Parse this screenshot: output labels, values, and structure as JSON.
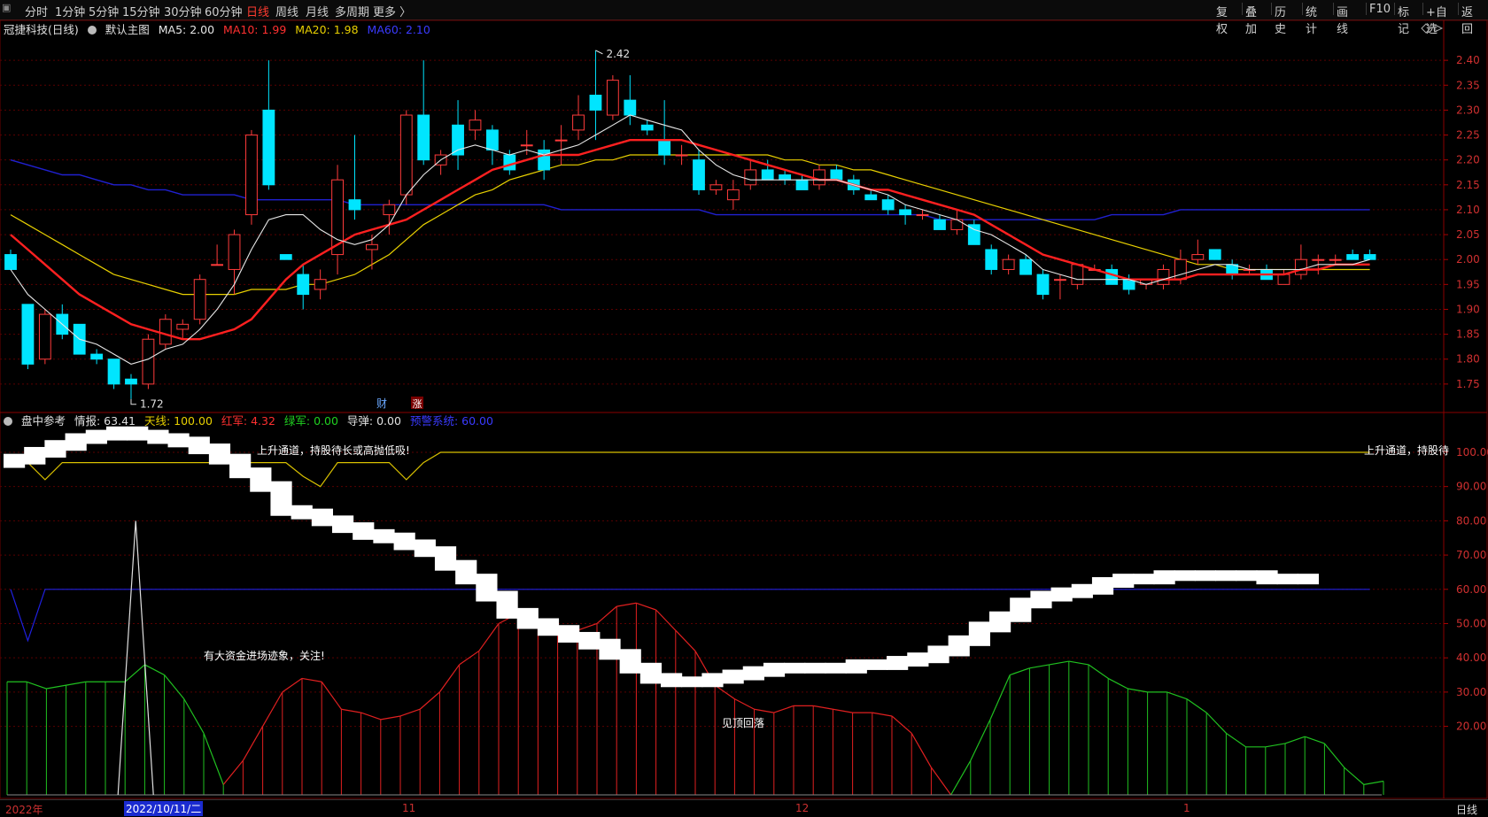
{
  "toolbar": {
    "left_items": [
      "分时",
      "1分钟",
      "5分钟",
      "15分钟",
      "30分钟",
      "60分钟",
      "日线",
      "周线",
      "月线",
      "多周期",
      "更多 〉"
    ],
    "active": "日线",
    "right_items": [
      "复权",
      "叠加",
      "历史",
      "统计",
      "画线",
      "F10",
      "标记",
      "+自选",
      "返回"
    ]
  },
  "main_legend": {
    "stock": "冠捷科技(日线)",
    "template": "默认主图",
    "ma5": "MA5: 2.00",
    "ma10": "MA10: 1.99",
    "ma20": "MA20: 1.98",
    "ma60": "MA60: 2.10"
  },
  "sub_legend": {
    "name": "盘中参考",
    "qingbao": "情报: 63.41",
    "tianxian": "天线: 100.00",
    "hongjun": "红军: 4.32",
    "lvjun": "绿军: 0.00",
    "daodan": "导弹: 0.00",
    "yujing": "预警系统: 60.00"
  },
  "colors": {
    "up": "#ff3b3b",
    "down": "#00e5ff",
    "ma5": "#e6e6e6",
    "ma10": "#ff2020",
    "ma20": "#e8d000",
    "ma60": "#2020d0",
    "grid": "#5a0000"
  },
  "price_axis": [
    "2.40",
    "2.35",
    "2.30",
    "2.25",
    "2.20",
    "2.15",
    "2.10",
    "2.05",
    "2.00",
    "1.95",
    "1.90",
    "1.85",
    "1.80",
    "1.75"
  ],
  "sub_axis": [
    "100.00",
    "90.00",
    "80.00",
    "70.00",
    "60.00",
    "50.00",
    "40.00",
    "30.00",
    "20.00"
  ],
  "annotations": {
    "high": "2.42",
    "low": "1.72",
    "cai": "财",
    "zhang": "涨",
    "up_channel": "上升通道，持股待长或高抛低吸!",
    "up_channel_right": "上升通道，持股待",
    "big_money": "有大资金进场迹象，关注!",
    "top_fall": "见顶回落"
  },
  "time_axis": {
    "year": "2022年",
    "cursor_date": "2022/10/11/二",
    "m11": "11",
    "m12": "12",
    "m1": "1",
    "period": "日线"
  },
  "chart_data": {
    "type": "candlestick",
    "ohlc": [
      [
        2.01,
        2.02,
        1.98,
        1.98
      ],
      [
        1.91,
        1.91,
        1.78,
        1.79
      ],
      [
        1.8,
        1.9,
        1.79,
        1.89
      ],
      [
        1.89,
        1.91,
        1.84,
        1.85
      ],
      [
        1.87,
        1.87,
        1.81,
        1.81
      ],
      [
        1.81,
        1.82,
        1.79,
        1.8
      ],
      [
        1.8,
        1.8,
        1.74,
        1.75
      ],
      [
        1.76,
        1.77,
        1.72,
        1.75
      ],
      [
        1.75,
        1.85,
        1.74,
        1.84
      ],
      [
        1.83,
        1.89,
        1.82,
        1.88
      ],
      [
        1.86,
        1.88,
        1.84,
        1.87
      ],
      [
        1.88,
        1.97,
        1.87,
        1.96
      ],
      [
        1.99,
        2.03,
        1.99,
        1.99
      ],
      [
        1.98,
        2.06,
        1.93,
        2.05
      ],
      [
        2.09,
        2.26,
        2.07,
        2.25
      ],
      [
        2.3,
        2.4,
        2.14,
        2.15
      ],
      [
        2.01,
        2.01,
        2.0,
        2.0
      ],
      [
        1.97,
        1.99,
        1.9,
        1.93
      ],
      [
        1.94,
        1.98,
        1.92,
        1.96
      ],
      [
        2.01,
        2.19,
        1.97,
        2.16
      ],
      [
        2.12,
        2.25,
        2.08,
        2.1
      ],
      [
        2.02,
        2.05,
        1.98,
        2.03
      ],
      [
        2.09,
        2.12,
        2.05,
        2.11
      ],
      [
        2.13,
        2.3,
        2.11,
        2.29
      ],
      [
        2.29,
        2.4,
        2.19,
        2.2
      ],
      [
        2.19,
        2.22,
        2.17,
        2.21
      ],
      [
        2.27,
        2.32,
        2.18,
        2.21
      ],
      [
        2.26,
        2.3,
        2.24,
        2.28
      ],
      [
        2.26,
        2.27,
        2.19,
        2.22
      ],
      [
        2.21,
        2.22,
        2.17,
        2.18
      ],
      [
        2.23,
        2.26,
        2.21,
        2.23
      ],
      [
        2.22,
        2.24,
        2.16,
        2.18
      ],
      [
        2.24,
        2.27,
        2.19,
        2.24
      ],
      [
        2.26,
        2.33,
        2.24,
        2.29
      ],
      [
        2.33,
        2.42,
        2.24,
        2.3
      ],
      [
        2.29,
        2.37,
        2.28,
        2.36
      ],
      [
        2.32,
        2.37,
        2.27,
        2.29
      ],
      [
        2.27,
        2.28,
        2.25,
        2.26
      ],
      [
        2.24,
        2.32,
        2.19,
        2.21
      ],
      [
        2.21,
        2.23,
        2.19,
        2.21
      ],
      [
        2.2,
        2.22,
        2.13,
        2.14
      ],
      [
        2.14,
        2.16,
        2.13,
        2.15
      ],
      [
        2.12,
        2.16,
        2.1,
        2.14
      ],
      [
        2.15,
        2.2,
        2.14,
        2.18
      ],
      [
        2.18,
        2.2,
        2.16,
        2.16
      ],
      [
        2.17,
        2.18,
        2.15,
        2.16
      ],
      [
        2.16,
        2.17,
        2.14,
        2.14
      ],
      [
        2.15,
        2.19,
        2.14,
        2.18
      ],
      [
        2.18,
        2.19,
        2.16,
        2.16
      ],
      [
        2.16,
        2.17,
        2.13,
        2.14
      ],
      [
        2.13,
        2.14,
        2.12,
        2.12
      ],
      [
        2.12,
        2.13,
        2.09,
        2.1
      ],
      [
        2.1,
        2.11,
        2.07,
        2.09
      ],
      [
        2.09,
        2.1,
        2.08,
        2.09
      ],
      [
        2.08,
        2.09,
        2.06,
        2.06
      ],
      [
        2.06,
        2.1,
        2.05,
        2.08
      ],
      [
        2.07,
        2.08,
        2.03,
        2.03
      ],
      [
        2.02,
        2.03,
        1.97,
        1.98
      ],
      [
        1.98,
        2.01,
        1.97,
        2.0
      ],
      [
        2.0,
        2.01,
        1.97,
        1.97
      ],
      [
        1.97,
        1.98,
        1.92,
        1.93
      ],
      [
        1.96,
        1.97,
        1.92,
        1.96
      ],
      [
        1.95,
        1.99,
        1.94,
        1.99
      ],
      [
        1.98,
        1.99,
        1.98,
        1.98
      ],
      [
        1.98,
        1.99,
        1.95,
        1.95
      ],
      [
        1.96,
        1.97,
        1.93,
        1.94
      ],
      [
        1.95,
        1.96,
        1.94,
        1.96
      ],
      [
        1.95,
        1.99,
        1.94,
        1.98
      ],
      [
        1.96,
        2.02,
        1.95,
        2.0
      ],
      [
        2.0,
        2.04,
        1.99,
        2.01
      ],
      [
        2.02,
        2.02,
        2.0,
        2.0
      ],
      [
        1.99,
        2.0,
        1.96,
        1.97
      ],
      [
        1.98,
        1.99,
        1.97,
        1.98
      ],
      [
        1.98,
        1.99,
        1.96,
        1.96
      ],
      [
        1.95,
        1.98,
        1.95,
        1.97
      ],
      [
        1.97,
        2.03,
        1.96,
        2.0
      ],
      [
        2.0,
        2.01,
        1.97,
        2.0
      ],
      [
        2.0,
        2.01,
        1.99,
        2.0
      ],
      [
        2.01,
        2.02,
        2.0,
        2.0
      ],
      [
        2.01,
        2.02,
        2.0,
        2.0
      ]
    ],
    "ma5": [
      1.98,
      1.93,
      1.9,
      1.87,
      1.84,
      1.83,
      1.81,
      1.79,
      1.8,
      1.82,
      1.83,
      1.86,
      1.9,
      1.95,
      2.02,
      2.08,
      2.09,
      2.09,
      2.06,
      2.04,
      2.03,
      2.04,
      2.07,
      2.13,
      2.17,
      2.2,
      2.22,
      2.23,
      2.22,
      2.21,
      2.22,
      2.21,
      2.22,
      2.23,
      2.25,
      2.27,
      2.29,
      2.28,
      2.27,
      2.26,
      2.22,
      2.19,
      2.17,
      2.16,
      2.16,
      2.16,
      2.16,
      2.16,
      2.16,
      2.15,
      2.14,
      2.13,
      2.11,
      2.1,
      2.09,
      2.08,
      2.06,
      2.05,
      2.03,
      2.01,
      1.98,
      1.97,
      1.96,
      1.96,
      1.96,
      1.96,
      1.95,
      1.96,
      1.97,
      1.98,
      1.99,
      1.99,
      1.98,
      1.98,
      1.98,
      1.98,
      1.99,
      1.99,
      1.99,
      2.0
    ],
    "ma10": [
      2.05,
      2.02,
      1.99,
      1.96,
      1.93,
      1.91,
      1.89,
      1.87,
      1.86,
      1.85,
      1.84,
      1.84,
      1.85,
      1.86,
      1.88,
      1.92,
      1.96,
      1.99,
      2.01,
      2.03,
      2.05,
      2.06,
      2.07,
      2.08,
      2.1,
      2.12,
      2.14,
      2.16,
      2.18,
      2.19,
      2.2,
      2.21,
      2.21,
      2.21,
      2.22,
      2.23,
      2.24,
      2.24,
      2.24,
      2.24,
      2.23,
      2.22,
      2.21,
      2.2,
      2.19,
      2.18,
      2.17,
      2.16,
      2.16,
      2.15,
      2.14,
      2.14,
      2.13,
      2.12,
      2.11,
      2.1,
      2.09,
      2.07,
      2.05,
      2.03,
      2.01,
      2.0,
      1.99,
      1.98,
      1.97,
      1.96,
      1.96,
      1.96,
      1.96,
      1.97,
      1.97,
      1.97,
      1.97,
      1.97,
      1.97,
      1.98,
      1.98,
      1.99,
      1.99,
      1.99
    ],
    "ma20": [
      2.09,
      2.07,
      2.05,
      2.03,
      2.01,
      1.99,
      1.97,
      1.96,
      1.95,
      1.94,
      1.93,
      1.93,
      1.93,
      1.93,
      1.94,
      1.94,
      1.94,
      1.95,
      1.95,
      1.96,
      1.97,
      1.99,
      2.01,
      2.04,
      2.07,
      2.09,
      2.11,
      2.13,
      2.14,
      2.16,
      2.17,
      2.18,
      2.19,
      2.19,
      2.2,
      2.2,
      2.21,
      2.21,
      2.21,
      2.21,
      2.21,
      2.21,
      2.21,
      2.21,
      2.21,
      2.2,
      2.2,
      2.19,
      2.19,
      2.18,
      2.18,
      2.17,
      2.16,
      2.15,
      2.14,
      2.13,
      2.12,
      2.11,
      2.1,
      2.09,
      2.08,
      2.07,
      2.06,
      2.05,
      2.04,
      2.03,
      2.02,
      2.01,
      2.0,
      1.99,
      1.99,
      1.98,
      1.98,
      1.98,
      1.98,
      1.98,
      1.98,
      1.98,
      1.98,
      1.98
    ],
    "ma60": [
      2.2,
      2.19,
      2.18,
      2.17,
      2.17,
      2.16,
      2.15,
      2.15,
      2.14,
      2.14,
      2.13,
      2.13,
      2.13,
      2.13,
      2.12,
      2.12,
      2.12,
      2.12,
      2.12,
      2.12,
      2.11,
      2.11,
      2.11,
      2.11,
      2.11,
      2.11,
      2.11,
      2.11,
      2.11,
      2.11,
      2.11,
      2.11,
      2.1,
      2.1,
      2.1,
      2.1,
      2.1,
      2.1,
      2.1,
      2.1,
      2.1,
      2.09,
      2.09,
      2.09,
      2.09,
      2.09,
      2.09,
      2.09,
      2.09,
      2.09,
      2.09,
      2.09,
      2.09,
      2.09,
      2.08,
      2.08,
      2.08,
      2.08,
      2.08,
      2.08,
      2.08,
      2.08,
      2.08,
      2.08,
      2.09,
      2.09,
      2.09,
      2.09,
      2.1,
      2.1,
      2.1,
      2.1,
      2.1,
      2.1,
      2.1,
      2.1,
      2.1,
      2.1,
      2.1,
      2.1
    ],
    "ylim": [
      1.7,
      2.45
    ],
    "sub_ylim": [
      0,
      108
    ],
    "sub_tianxian": [
      97,
      97,
      92,
      97,
      97,
      97,
      97,
      97,
      97,
      97,
      97,
      97,
      97,
      97,
      97,
      97,
      97,
      93,
      90,
      97,
      97,
      97,
      97,
      92,
      97,
      100,
      100,
      100,
      100,
      100,
      100,
      100,
      100,
      100,
      100,
      100,
      100,
      100,
      100,
      100,
      100,
      100,
      100,
      100,
      100,
      100,
      100,
      100,
      100,
      100,
      100,
      100,
      100,
      100,
      100,
      100,
      100,
      100,
      100,
      100,
      100,
      100,
      100,
      100,
      100,
      100,
      100,
      100,
      100,
      100,
      100,
      100,
      100,
      100,
      100,
      100,
      100,
      100,
      100,
      100
    ],
    "sub_yujing": [
      60,
      45,
      60,
      60,
      60,
      60,
      60,
      60,
      60,
      60,
      60,
      60,
      60,
      60,
      60,
      60,
      60,
      60,
      60,
      60,
      60,
      60,
      60,
      60,
      60,
      60,
      60,
      60,
      60,
      60,
      60,
      60,
      60,
      60,
      60,
      60,
      60,
      60,
      60,
      60,
      60,
      60,
      60,
      60,
      60,
      60,
      60,
      60,
      60,
      60,
      60,
      60,
      60,
      60,
      60,
      60,
      60,
      60,
      60,
      60,
      60,
      60,
      60,
      60,
      60,
      60,
      60,
      60,
      60,
      60,
      60,
      60,
      60,
      60,
      60,
      60,
      60,
      60,
      60,
      60
    ],
    "sub_daodan": [
      0,
      0,
      0,
      0,
      0,
      0,
      80,
      0,
      0,
      0,
      0,
      0,
      0,
      0,
      0,
      0,
      0,
      0,
      0,
      0,
      0,
      0,
      0,
      0,
      0,
      0,
      0,
      0,
      0,
      0,
      0,
      0,
      0,
      0,
      0,
      0,
      0,
      0,
      0,
      0,
      0,
      0,
      0,
      0,
      0,
      0,
      0,
      0,
      0,
      0,
      0,
      0,
      0,
      0,
      0,
      0,
      0,
      0,
      0,
      0,
      0,
      0,
      0,
      0,
      0,
      0,
      0,
      0,
      0,
      0,
      0,
      0,
      0,
      0,
      0,
      0,
      0,
      0,
      0,
      0
    ],
    "sub_army": [
      33,
      33,
      31,
      32,
      33,
      33,
      33,
      38,
      35,
      28,
      18,
      3,
      -10,
      -20,
      -30,
      -34,
      -33,
      -25,
      -24,
      -22,
      -23,
      -25,
      -30,
      -38,
      -42,
      -50,
      -53,
      -50,
      -48,
      -48,
      -50,
      -55,
      -56,
      -54,
      -48,
      -42,
      -32,
      -28,
      -25,
      -24,
      -26,
      -26,
      -25,
      -24,
      -24,
      -23,
      -18,
      -8,
      0,
      10,
      22,
      35,
      37,
      38,
      39,
      38,
      34,
      31,
      30,
      30,
      28,
      24,
      18,
      14,
      14,
      15,
      17,
      15,
      8,
      3,
      4
    ],
    "sub_qingbao": [
      97,
      98,
      100,
      102,
      104,
      105,
      106,
      105,
      104,
      103,
      101,
      98,
      94,
      90,
      83,
      82,
      80,
      78,
      76,
      75,
      73,
      71,
      67,
      63,
      58,
      53,
      50,
      48,
      46,
      44,
      41,
      37,
      34,
      33,
      33,
      34,
      35,
      36,
      37,
      37,
      37,
      37,
      38,
      38,
      39,
      40,
      42,
      45,
      49,
      52,
      56,
      58,
      59,
      60,
      62,
      63,
      63,
      64,
      64,
      64,
      64,
      64,
      63,
      63,
      63
    ]
  }
}
